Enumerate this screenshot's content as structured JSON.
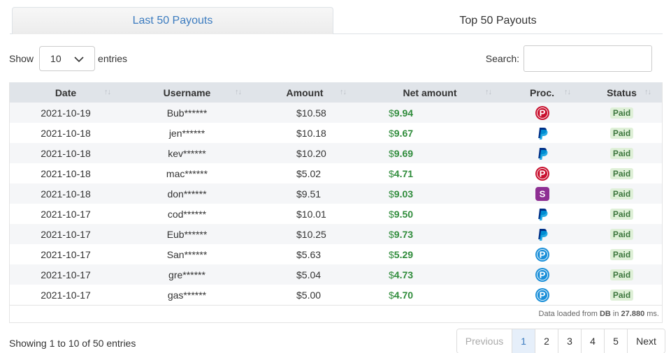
{
  "tabs": [
    {
      "label": "Last 50 Payouts",
      "active": true
    },
    {
      "label": "Top 50 Payouts",
      "active": false
    }
  ],
  "controls": {
    "show_label": "Show",
    "entries_value": "10",
    "entries_label": "entries",
    "search_label": "Search:",
    "search_value": ""
  },
  "table": {
    "columns": [
      "Date",
      "Username",
      "Amount",
      "Net amount",
      "Proc.",
      "Status"
    ],
    "rows": [
      {
        "date": "2021-10-19",
        "user": "Bub******",
        "amount": "$10.58",
        "net_cur": "$",
        "net": "9.94",
        "proc": "p-red-icon",
        "status": "Paid"
      },
      {
        "date": "2021-10-18",
        "user": "jen******",
        "amount": "$10.18",
        "net_cur": "$",
        "net": "9.67",
        "proc": "paypal-icon",
        "status": "Paid"
      },
      {
        "date": "2021-10-18",
        "user": "kev******",
        "amount": "$10.20",
        "net_cur": "$",
        "net": "9.69",
        "proc": "paypal-icon",
        "status": "Paid"
      },
      {
        "date": "2021-10-18",
        "user": "mac******",
        "amount": "$5.02",
        "net_cur": "$",
        "net": "4.71",
        "proc": "p-red-icon",
        "status": "Paid"
      },
      {
        "date": "2021-10-18",
        "user": "don******",
        "amount": "$9.51",
        "net_cur": "$",
        "net": "9.03",
        "proc": "s-purple-icon",
        "status": "Paid"
      },
      {
        "date": "2021-10-17",
        "user": "cod******",
        "amount": "$10.01",
        "net_cur": "$",
        "net": "9.50",
        "proc": "paypal-icon",
        "status": "Paid"
      },
      {
        "date": "2021-10-17",
        "user": "Eub******",
        "amount": "$10.25",
        "net_cur": "$",
        "net": "9.73",
        "proc": "paypal-icon",
        "status": "Paid"
      },
      {
        "date": "2021-10-17",
        "user": "San******",
        "amount": "$5.63",
        "net_cur": "$",
        "net": "5.29",
        "proc": "p-blue-icon",
        "status": "Paid"
      },
      {
        "date": "2021-10-17",
        "user": "gre******",
        "amount": "$5.04",
        "net_cur": "$",
        "net": "4.73",
        "proc": "p-blue-icon",
        "status": "Paid"
      },
      {
        "date": "2021-10-17",
        "user": "gas******",
        "amount": "$5.00",
        "net_cur": "$",
        "net": "4.70",
        "proc": "p-blue-icon",
        "status": "Paid"
      }
    ],
    "loaded_prefix": "Data loaded from",
    "loaded_source": "DB",
    "loaded_in": "in",
    "loaded_time": "27.880",
    "loaded_unit": "ms."
  },
  "footer": {
    "info": "Showing 1 to 10 of 50 entries",
    "previous": "Previous",
    "pages": [
      "1",
      "2",
      "3",
      "4",
      "5"
    ],
    "active_page": "1",
    "next": "Next"
  },
  "colors": {
    "accent": "#3b7bbf",
    "net_green": "#2e8b3a",
    "badge_bg": "#dff0d8",
    "p_red": "#c8102e",
    "paypal_dark": "#003087",
    "paypal_light": "#009cde",
    "s_purple": "#8e2f93",
    "p_blue": "#1a8fd8"
  }
}
